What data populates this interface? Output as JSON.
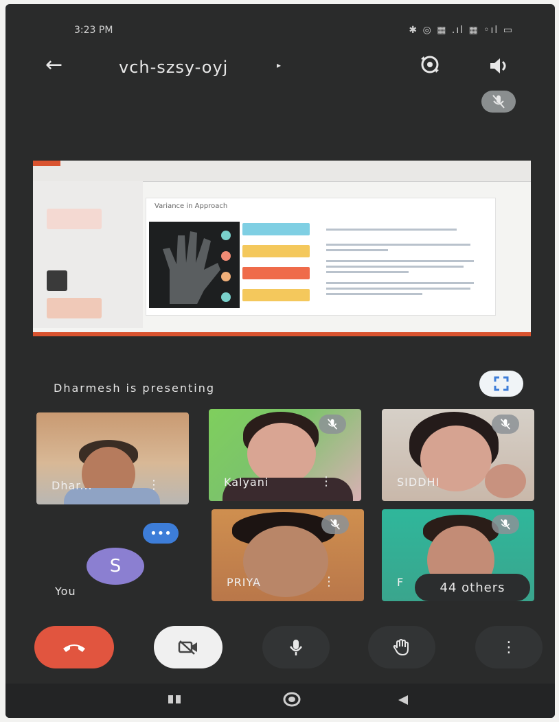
{
  "status_bar": {
    "time": "3:23 PM",
    "icons": "✱ ◎ ▦ .ıl ▦ ◦ıl ▭"
  },
  "header": {
    "meeting_code": "vch-szsy-oyj",
    "caret": "▸"
  },
  "presentation": {
    "slide_title": "Variance in Approach",
    "presenter_text": "Dharmesh is presenting"
  },
  "participants": [
    {
      "name": "Dhar...",
      "muted": false
    },
    {
      "name": "Kalyani",
      "muted": true
    },
    {
      "name": "SIDDHI",
      "muted": true
    },
    {
      "name": "PRIYA",
      "muted": true
    },
    {
      "name": "F",
      "muted": true
    }
  ],
  "self_tile": {
    "initial": "S",
    "label": "You",
    "more": "•••"
  },
  "others_count_label": "44 others",
  "controls": {
    "menu": "⋮"
  },
  "colors": {
    "end_call": "#e1553f",
    "avatar": "#8b7fd1",
    "accent": "#3d7dd8",
    "slide_bar": "#d9532f"
  }
}
